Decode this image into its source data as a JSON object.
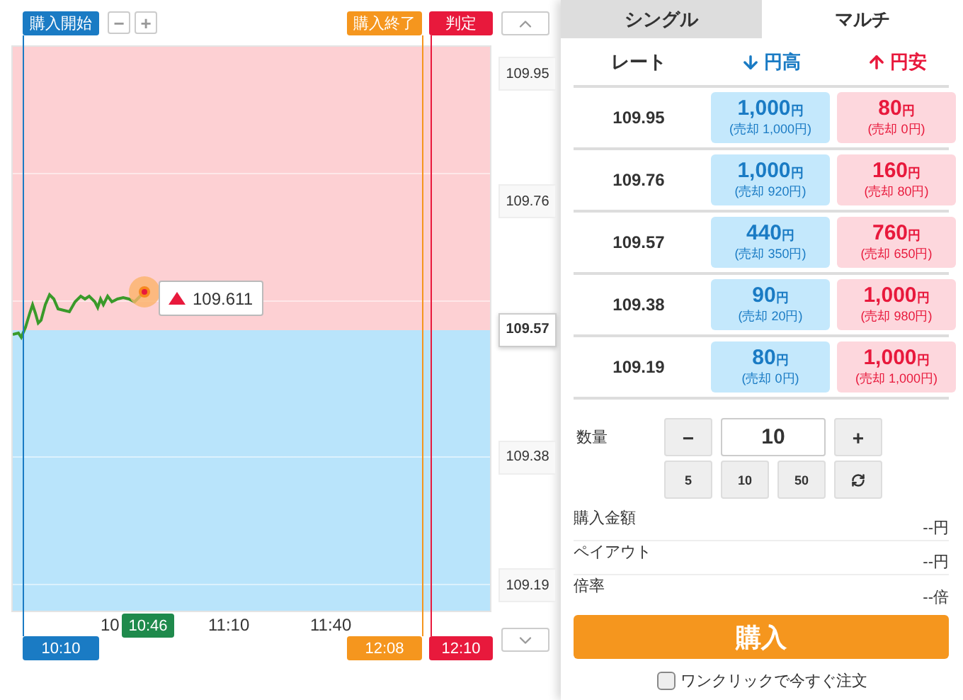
{
  "chart": {
    "markers": [
      {
        "kind": "start",
        "label": "購入開始",
        "time": "10:10"
      },
      {
        "kind": "end",
        "label": "購入終了",
        "time": "12:08"
      },
      {
        "kind": "judge",
        "label": "判定",
        "time": "12:10"
      }
    ],
    "zoom_buttons": [
      "−",
      "+"
    ],
    "price_labels": [
      {
        "value": "109.95",
        "selected": false
      },
      {
        "value": "109.76",
        "selected": false
      },
      {
        "value": "109.57",
        "selected": true
      },
      {
        "value": "109.38",
        "selected": false
      },
      {
        "value": "109.19",
        "selected": false
      }
    ],
    "time_labels": [
      "10",
      "11:10",
      "11:40"
    ],
    "current_time": "10:46",
    "current_price": {
      "kind": "up",
      "value": "109.611"
    }
  },
  "tabs": [
    {
      "label": "シングル",
      "selected": false
    },
    {
      "label": "マルチ",
      "selected": true
    }
  ],
  "table": {
    "columns": [
      {
        "kind": "rate",
        "label": "レート"
      },
      {
        "kind": "down",
        "label": "円高"
      },
      {
        "kind": "up",
        "label": "円安"
      }
    ],
    "rows": [
      {
        "rate": "109.95",
        "high": {
          "amount": "1,000",
          "unit": "円",
          "sell": "(売却 1,000円)"
        },
        "low": {
          "amount": "80",
          "unit": "円",
          "sell": "(売却 0円)"
        }
      },
      {
        "rate": "109.76",
        "high": {
          "amount": "1,000",
          "unit": "円",
          "sell": "(売却 920円)"
        },
        "low": {
          "amount": "160",
          "unit": "円",
          "sell": "(売却 80円)"
        }
      },
      {
        "rate": "109.57",
        "high": {
          "amount": "440",
          "unit": "円",
          "sell": "(売却 350円)"
        },
        "low": {
          "amount": "760",
          "unit": "円",
          "sell": "(売却 650円)"
        }
      },
      {
        "rate": "109.38",
        "high": {
          "amount": "90",
          "unit": "円",
          "sell": "(売却 20円)"
        },
        "low": {
          "amount": "1,000",
          "unit": "円",
          "sell": "(売却 980円)"
        }
      },
      {
        "rate": "109.19",
        "high": {
          "amount": "80",
          "unit": "円",
          "sell": "(売却 0円)"
        },
        "low": {
          "amount": "1,000",
          "unit": "円",
          "sell": "(売却 1,000円)"
        }
      }
    ]
  },
  "quantity": {
    "label": "数量",
    "minus": "−",
    "value": "10",
    "plus": "+",
    "presets": [
      "5",
      "10",
      "50"
    ]
  },
  "summary": [
    {
      "label": "購入金額",
      "value": "--円"
    },
    {
      "label": "ペイアウト",
      "value": "--円"
    },
    {
      "label": "倍率",
      "value": "--倍"
    }
  ],
  "buy_button": "購入",
  "one_click": {
    "label": "ワンクリックで今すぐ注文",
    "checked": false
  }
}
